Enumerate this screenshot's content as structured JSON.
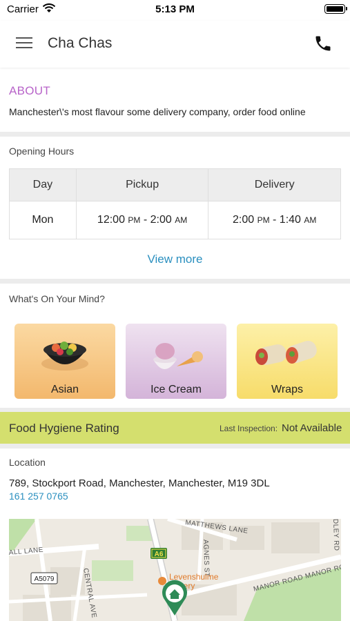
{
  "status": {
    "carrier": "Carrier",
    "time": "5:13 PM"
  },
  "nav": {
    "title": "Cha Chas"
  },
  "about": {
    "title": "ABOUT",
    "text": "Manchester\\'s most flavour some delivery company, order food online"
  },
  "opening_hours": {
    "title": "Opening Hours",
    "headers": [
      "Day",
      "Pickup",
      "Delivery"
    ],
    "rows": [
      {
        "day": "Mon",
        "pickup_start": "12:00",
        "pickup_start_ampm": "PM",
        "pickup_end": "2:00",
        "pickup_end_ampm": "AM",
        "delivery_start": "2:00",
        "delivery_start_ampm": "PM",
        "delivery_end": "1:40",
        "delivery_end_ampm": "AM",
        "separator": "-"
      }
    ],
    "view_more": "View more"
  },
  "mind": {
    "title": "What's On Your Mind?",
    "categories": [
      {
        "label": "Asian",
        "icon": "poke-bowl-icon"
      },
      {
        "label": "Ice Cream",
        "icon": "ice-cream-icon"
      },
      {
        "label": "Wraps",
        "icon": "wrap-icon"
      }
    ]
  },
  "hygiene": {
    "title": "Food Hygiene Rating",
    "last_label": "Last Inspection:",
    "last_value": "Not Available",
    "color": "#d4df6e"
  },
  "location": {
    "title": "Location",
    "address": "789, Stockport Road, Manchester, Manchester, M19 3DL",
    "phone": "161 257 0765",
    "map": {
      "road_labels": [
        "MATTHEWS LANE",
        "AGNES ST",
        "ALL LANE",
        "CENTRAL AVE",
        "MANOR ROAD MANOR ROAD",
        "DLEY RD"
      ],
      "road_badges": [
        "A6",
        "A5079"
      ],
      "poi": "Levenshulme Bakery"
    }
  },
  "colors": {
    "accent": "#b864c9",
    "link": "#2a8fbf",
    "divider": "#ececec"
  }
}
